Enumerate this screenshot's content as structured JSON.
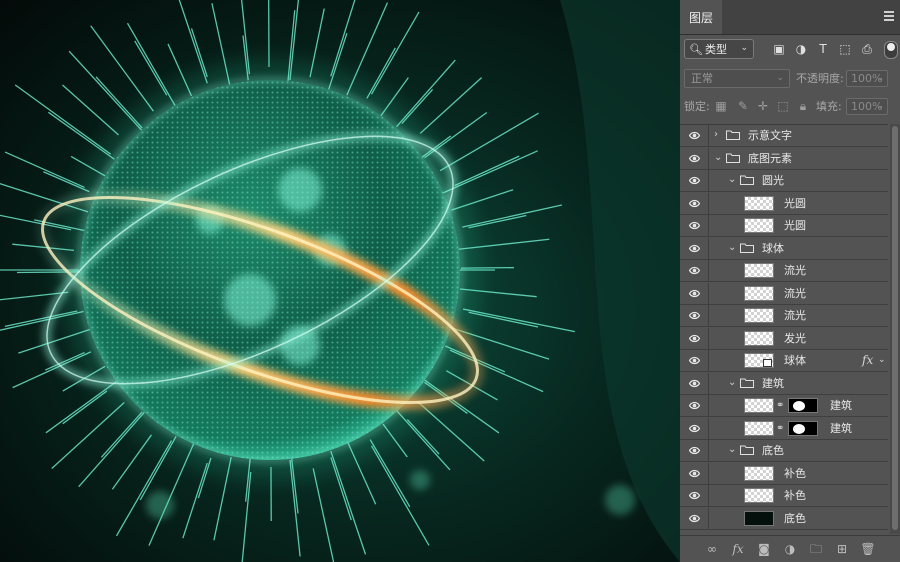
{
  "panel": {
    "tab_label": "图层",
    "filter_kind": "类型",
    "blend_mode": "正常",
    "opacity_label": "不透明度:",
    "opacity_value": "100%",
    "lock_label": "锁定:",
    "fill_label": "填充:",
    "fill_value": "100%"
  },
  "layers": [
    {
      "name": "示意文字",
      "type": "group",
      "depth": 0,
      "expanded": false
    },
    {
      "name": "底图元素",
      "type": "group",
      "depth": 0,
      "expanded": true
    },
    {
      "name": "圆光",
      "type": "group",
      "depth": 1,
      "expanded": true
    },
    {
      "name": "光圆",
      "type": "layer",
      "depth": 2
    },
    {
      "name": "光圆",
      "type": "layer",
      "depth": 2
    },
    {
      "name": "球体",
      "type": "group",
      "depth": 1,
      "expanded": true
    },
    {
      "name": "流光",
      "type": "layer",
      "depth": 2
    },
    {
      "name": "流光",
      "type": "layer",
      "depth": 2
    },
    {
      "name": "流光",
      "type": "layer",
      "depth": 2
    },
    {
      "name": "发光",
      "type": "layer",
      "depth": 2
    },
    {
      "name": "球体",
      "type": "smart",
      "depth": 2,
      "fx": "fx"
    },
    {
      "name": "建筑",
      "type": "group",
      "depth": 1,
      "expanded": true
    },
    {
      "name": "建筑",
      "type": "masked",
      "depth": 2
    },
    {
      "name": "建筑",
      "type": "masked",
      "depth": 2
    },
    {
      "name": "底色",
      "type": "group",
      "depth": 1,
      "expanded": true
    },
    {
      "name": "补色",
      "type": "layer",
      "depth": 2
    },
    {
      "name": "补色",
      "type": "layer",
      "depth": 2
    },
    {
      "name": "底色",
      "type": "solid",
      "depth": 2
    }
  ],
  "colors": {
    "panel_bg": "#535353",
    "canvas_bg": "#0a1410",
    "glow_green": "#3de0b0",
    "glow_orange": "#ff9a2e"
  }
}
